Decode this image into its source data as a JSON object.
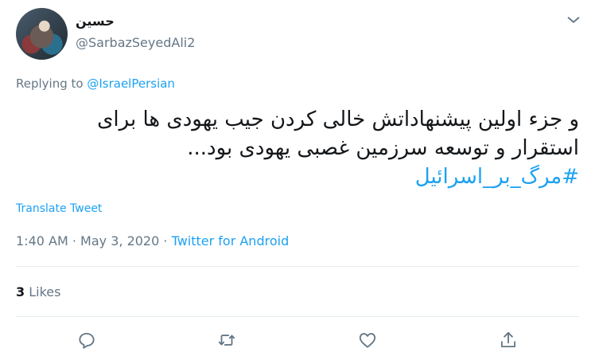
{
  "user": {
    "display_name": "حسین",
    "handle": "@SarbazSeyedAli2"
  },
  "reply": {
    "prefix": "Replying to",
    "to": "@IsraelPersian"
  },
  "tweet": {
    "line1": "و جزء اولین پیشنهاداتش خالی کردن جیب یهودی ها برای",
    "line2": "استقرار و توسعه سرزمین غصبی یهودی بود...",
    "hashtag": "#مرگ_بر_اسرائیل"
  },
  "translate_label": "Translate Tweet",
  "meta": {
    "time": "1:40 AM",
    "dot1": "·",
    "date": "May 3, 2020",
    "dot2": "·",
    "source": "Twitter for Android"
  },
  "stats": {
    "likes_count": "3",
    "likes_label": "Likes"
  },
  "actions": [
    "reply-icon",
    "retweet-icon",
    "like-icon",
    "share-icon"
  ],
  "colors": {
    "accent": "#1da1f2",
    "muted": "#657786",
    "text": "#14171a",
    "border": "#e6ecf0"
  }
}
